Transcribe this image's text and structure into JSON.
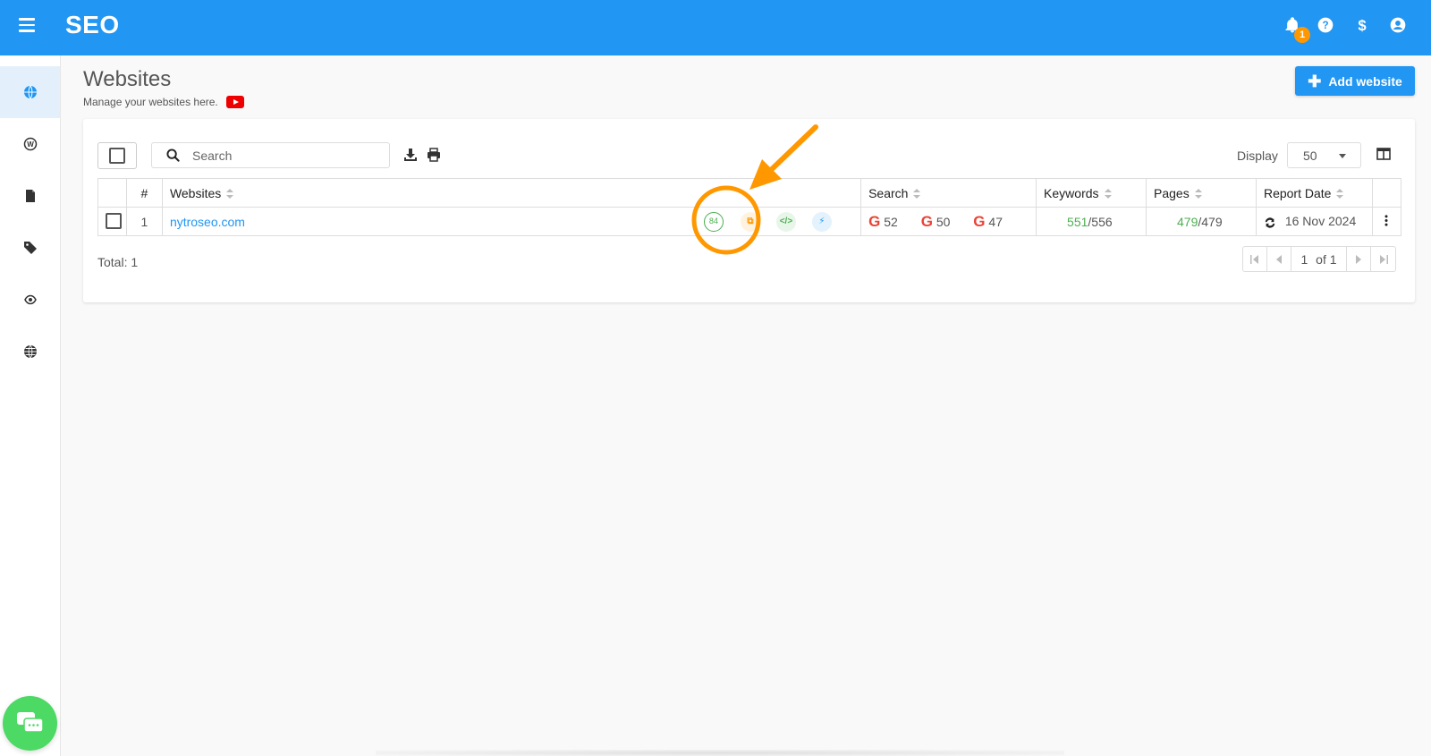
{
  "app": {
    "title": "SEO",
    "notification_count": "1"
  },
  "header": {
    "title": "Websites",
    "subtitle": "Manage your websites here.",
    "add_button_label": "Add website"
  },
  "toolbar": {
    "search_placeholder": "Search",
    "display_label": "Display",
    "display_value": "50"
  },
  "table": {
    "headers": {
      "num": "#",
      "websites": "Websites",
      "search": "Search",
      "keywords": "Keywords",
      "pages": "Pages",
      "report_date": "Report Date"
    },
    "rows": [
      {
        "num": "1",
        "website": "nytroseo.com",
        "score": "84",
        "google_1": "52",
        "google_2": "50",
        "google_3": "47",
        "keywords_ok": "551",
        "keywords_total": "/556",
        "pages_ok": "479",
        "pages_total": "/479",
        "report_date": "16 Nov 2024"
      }
    ]
  },
  "footer": {
    "total": "Total: 1",
    "page_current": "1",
    "page_of": "of 1"
  },
  "colors": {
    "primary": "#2196f3",
    "accent_orange": "#ff9800",
    "success_green": "#4caf50",
    "google_red": "#ea4335",
    "chat_green": "#4cd964"
  },
  "icons": [
    "menu-icon",
    "bell-icon",
    "help-icon",
    "dollar-icon",
    "account-icon",
    "globe-icon",
    "wordpress-icon",
    "file-icon",
    "tag-icon",
    "eye-sync-icon",
    "language-icon",
    "chat-icon",
    "youtube-icon",
    "search-icon",
    "download-icon",
    "print-icon",
    "columns-icon",
    "google-icon",
    "refresh-icon",
    "more-vert-icon"
  ]
}
